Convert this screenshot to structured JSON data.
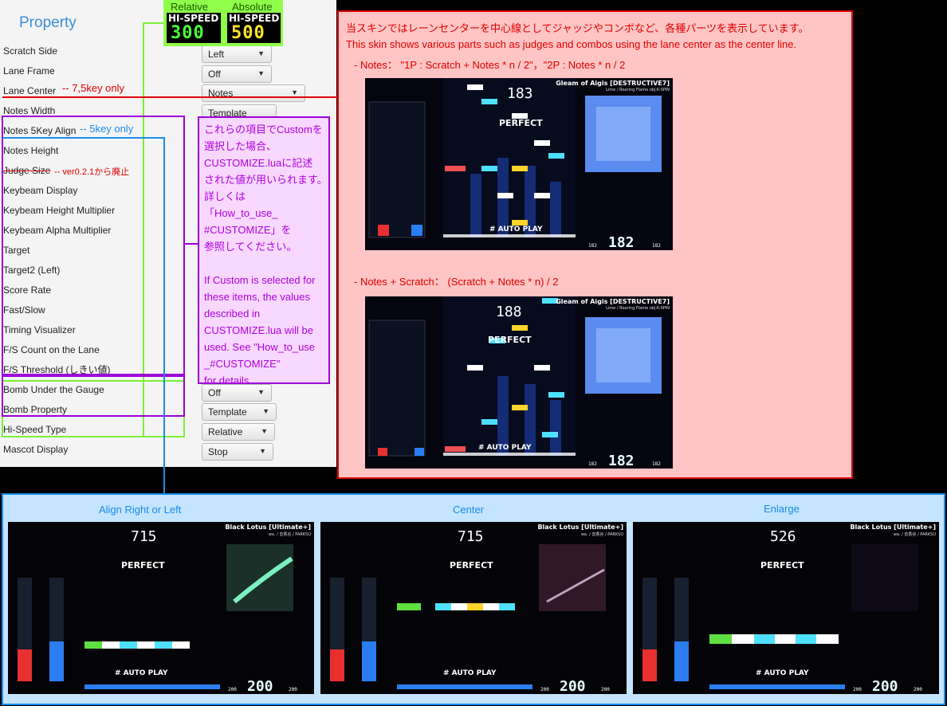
{
  "panel": {
    "title": "Property",
    "rows": [
      "Scratch Side",
      "Lane Frame",
      "Lane Center",
      "Notes Width",
      "Notes 5Key Align",
      "Notes Height",
      "Judge Size",
      "Keybeam Display",
      "Keybeam Height Multiplier",
      "Keybeam Alpha Multiplier",
      "Target",
      "Target2 (Left)",
      "Score Rate",
      "Fast/Slow",
      "Timing Visualizer",
      "F/S Count on the Lane",
      "F/S Threshold (しきい値)",
      "Bomb Under the Gauge",
      "Bomb Property",
      "Hi-Speed Type",
      "Mascot Display"
    ],
    "combos": [
      "Left",
      "Off",
      "Notes",
      "Template",
      "Off",
      "Template",
      "Relative",
      "Stop"
    ]
  },
  "notes": {
    "lane_center": "-- 7,5key only",
    "notes_align": "-- 5key only",
    "judge_size": "-- ver0.2.1から廃止"
  },
  "hispeed": {
    "relative_label": "Relative",
    "absolute_label": "Absolute",
    "head": "HI-SPEED",
    "relative_value": "300",
    "absolute_value": "500"
  },
  "purple": {
    "jp": "これらの項目でCustomを\n選択した場合、\nCUSTOMIZE.luaに記述\nされた値が用いられます。\n詳しくは\n「How_to_use_\n#CUSTOMIZE」を\n参照してください。",
    "en": "If Custom is selected for\nthese items, the values\ndescribed in\nCUSTOMIZE.lua will be\nused. See \"How_to_use\n_#CUSTOMIZE\"\nfor details."
  },
  "red": {
    "line1": "当スキンではレーンセンターを中心線としてジャッジやコンボなど、各種パーツを表示しています。",
    "line2": "This skin shows various parts such as judges and combos using the lane center as the center line.",
    "line3": "- Notes： \"1P : Scratch + Notes * n / 2\"，\"2P : Notes * n / 2",
    "line4": "- Notes + Scratch： (Scratch + Notes * n) / 2"
  },
  "blue": {
    "headers": [
      "Align Right or Left",
      "Center",
      "Enlarge"
    ]
  },
  "screens": {
    "top": [
      {
        "title": "Gleam of Aigis [DESTRUCTIVE7]",
        "sub": "Lime / Roaring Flame obj:K-SPIN",
        "combo": "183",
        "judge": "PERFECT",
        "auto": "# AUTO PLAY",
        "bpm": "182",
        "bpm_side": "182"
      },
      {
        "title": "Gleam of Aigis [DESTRUCTIVE7]",
        "sub": "Lime / Roaring Flame obj:K-SPIN",
        "combo": "188",
        "judge": "PERFECT",
        "auto": "# AUTO PLAY",
        "bpm": "182",
        "bpm_side": "182"
      }
    ],
    "bottom": [
      {
        "title": "Black Lotus [Ultimate+]",
        "sub": "wa. / 音香谷 / PARKSU",
        "combo": "715",
        "judge": "PERFECT",
        "auto": "# AUTO PLAY",
        "bpm": "200",
        "bpm_side": "200"
      },
      {
        "title": "Black Lotus [Ultimate+]",
        "sub": "wa. / 音香谷 / PARKSU",
        "combo": "715",
        "judge": "PERFECT",
        "auto": "# AUTO PLAY",
        "bpm": "200",
        "bpm_side": "200"
      },
      {
        "title": "Black Lotus [Ultimate+]",
        "sub": "wa. / 音香谷 / PARKSU",
        "combo": "526",
        "judge": "PERFECT",
        "auto": "# AUTO PLAY",
        "bpm": "200",
        "bpm_side": "200"
      }
    ]
  },
  "colors": {
    "red": "#e00000",
    "blue": "#1a8ce8",
    "purple": "#a000d8",
    "green": "#7cf03a"
  }
}
